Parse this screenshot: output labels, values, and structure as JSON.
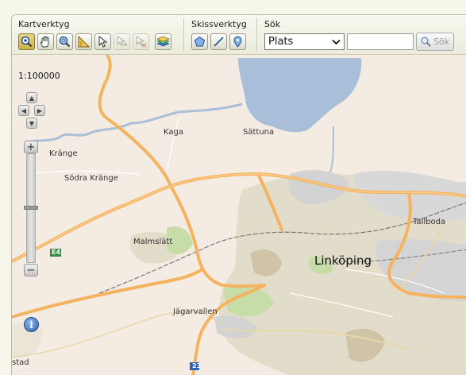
{
  "toolbar": {
    "map_tools_title": "Kartverktyg",
    "sketch_tools_title": "Skissverktyg",
    "search_title": "Sök",
    "map_tools": [
      {
        "name": "zoom-in-tool",
        "icon": "magnifier-plus-icon",
        "active": true
      },
      {
        "name": "pan-tool",
        "icon": "hand-icon",
        "active": false
      },
      {
        "name": "zoom-extent-tool",
        "icon": "magnifier-globe-icon",
        "active": false
      },
      {
        "name": "measure-tool",
        "icon": "ruler-icon",
        "active": false
      },
      {
        "name": "select-tool",
        "icon": "cursor-icon",
        "active": false
      },
      {
        "name": "add-point-tool",
        "icon": "cursor-plus-icon",
        "disabled": true
      },
      {
        "name": "remove-point-tool",
        "icon": "cursor-minus-icon",
        "disabled": true
      },
      {
        "name": "layers-tool",
        "icon": "layers-icon",
        "active": false
      }
    ],
    "sketch_tools": [
      {
        "name": "polygon-tool",
        "icon": "pentagon-icon"
      },
      {
        "name": "line-tool",
        "icon": "line-icon"
      },
      {
        "name": "point-tool",
        "icon": "pin-icon"
      }
    ],
    "search": {
      "category_selected": "Plats",
      "input_value": "",
      "button_label": "Sök"
    }
  },
  "map": {
    "scale": "1:100000",
    "places": {
      "kaga": "Kaga",
      "sattuna": "Sättuna",
      "krange": "Kränge",
      "sodra_krange": "Södra Kränge",
      "malmslatt": "Malmslätt",
      "linkoping": "Linköping",
      "tallboda": "Tallboda",
      "jagarvallen": "Jägarvallen",
      "stad": "stad"
    },
    "road_shields": {
      "e4": "E4",
      "r23": "23"
    },
    "colors": {
      "land": "#f4ece2",
      "water": "#a9bfd9",
      "major_road": "#f5b35f",
      "urban": "#e0dbc9",
      "park": "#c7dca6",
      "industrial": "#cfcfcf"
    }
  }
}
